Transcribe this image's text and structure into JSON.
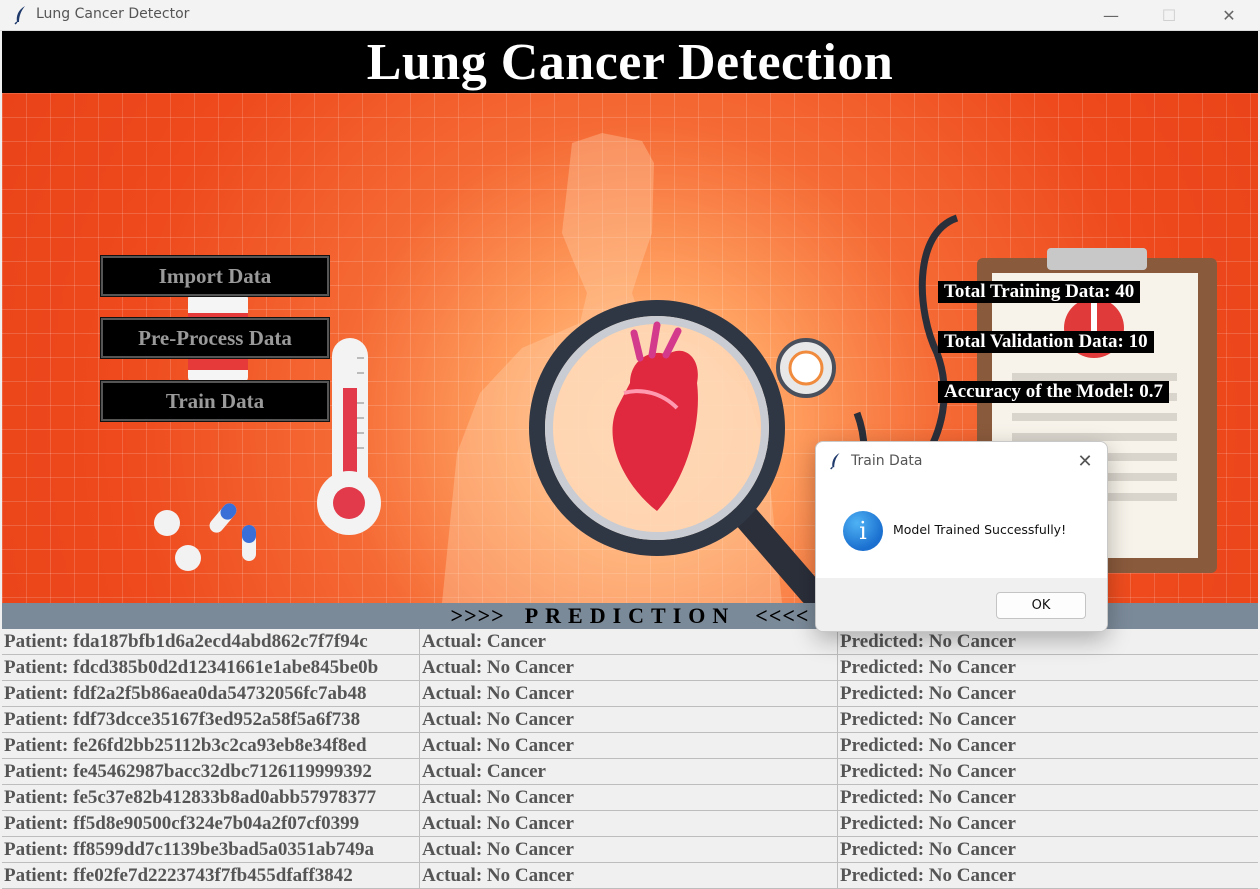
{
  "window": {
    "title": "Lung Cancer Detector",
    "minimize_glyph": "—",
    "maximize_glyph": "☐",
    "close_glyph": "✕"
  },
  "header": {
    "title": "Lung Cancer Detection"
  },
  "actions": {
    "import_label": "Import Data",
    "preprocess_label": "Pre-Process Data",
    "train_label": "Train Data"
  },
  "stats": {
    "training": "Total Training Data: 40",
    "validation": "Total Validation Data: 10",
    "accuracy": "Accuracy of the Model: 0.7"
  },
  "prediction": {
    "left_arrows": ">>>>",
    "title": "PREDICTION",
    "right_arrows": "<<<<",
    "rows": [
      {
        "patient": "Patient: fda187bfb1d6a2ecd4abd862c7f7f94c",
        "actual": "Actual: Cancer",
        "predicted": "Predicted: No Cancer"
      },
      {
        "patient": "Patient: fdcd385b0d2d12341661e1abe845be0b",
        "actual": "Actual: No Cancer",
        "predicted": "Predicted: No Cancer"
      },
      {
        "patient": "Patient: fdf2a2f5b86aea0da54732056fc7ab48",
        "actual": "Actual: No Cancer",
        "predicted": "Predicted: No Cancer"
      },
      {
        "patient": "Patient: fdf73dcce35167f3ed952a58f5a6f738",
        "actual": "Actual: No Cancer",
        "predicted": "Predicted: No Cancer"
      },
      {
        "patient": "Patient: fe26fd2bb25112b3c2ca93eb8e34f8ed",
        "actual": "Actual: No Cancer",
        "predicted": "Predicted: No Cancer"
      },
      {
        "patient": "Patient: fe45462987bacc32dbc7126119999392",
        "actual": "Actual: Cancer",
        "predicted": "Predicted: No Cancer"
      },
      {
        "patient": "Patient: fe5c37e82b412833b8ad0abb57978377",
        "actual": "Actual: No Cancer",
        "predicted": "Predicted: No Cancer"
      },
      {
        "patient": "Patient: ff5d8e90500cf324e7b04a2f07cf0399",
        "actual": "Actual: No Cancer",
        "predicted": "Predicted: No Cancer"
      },
      {
        "patient": "Patient: ff8599dd7c1139be3bad5a0351ab749a",
        "actual": "Actual: No Cancer",
        "predicted": "Predicted: No Cancer"
      },
      {
        "patient": "Patient: ffe02fe7d2223743f7fb455dfaff3842",
        "actual": "Actual: No Cancer",
        "predicted": "Predicted: No Cancer"
      }
    ]
  },
  "dialog": {
    "title": "Train Data",
    "message": "Model Trained Successfully!",
    "ok_label": "OK",
    "close_glyph": "✕",
    "info_glyph": "i"
  },
  "colors": {
    "background_orange": "#ee4a1d",
    "header_black": "#000000",
    "prediction_bar": "#7b8a99",
    "info_blue": "#1a6fcf"
  },
  "icons": [
    "feather-icon",
    "heart-icon",
    "magnifier-icon",
    "thermometer-icon",
    "stethoscope-icon",
    "clipboard-icon",
    "pills-icon",
    "info-icon"
  ]
}
